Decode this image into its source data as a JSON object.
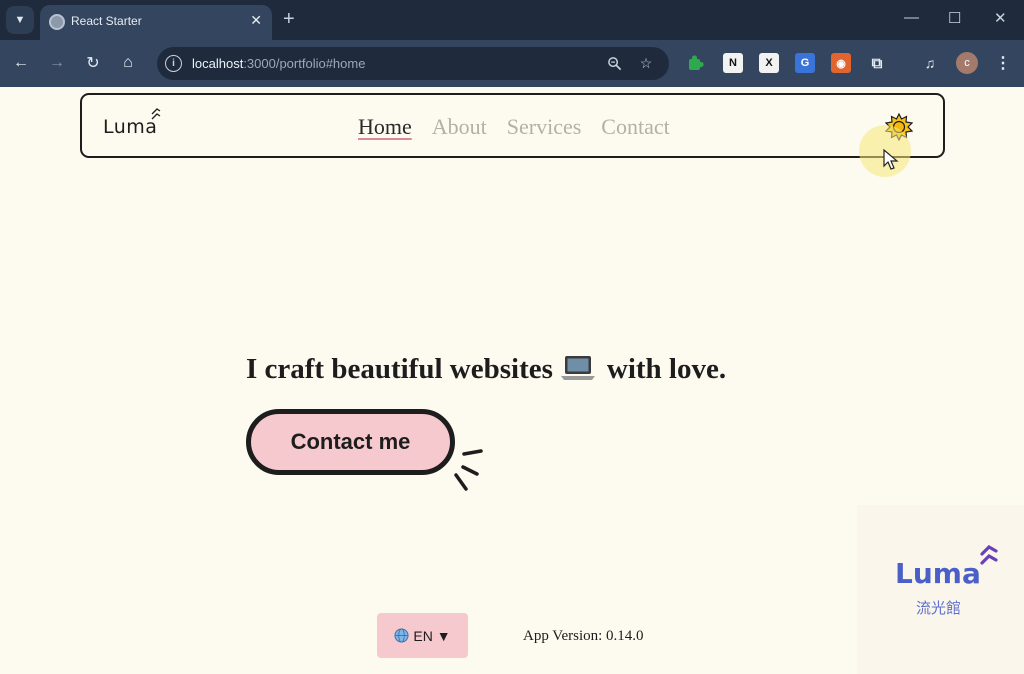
{
  "browser": {
    "tab_title": "React Starter",
    "url_host": "localhost",
    "url_path": ":3000/portfolio#home",
    "profile_initial": "c"
  },
  "nav": {
    "logo": "Luma",
    "links": [
      "Home",
      "About",
      "Services",
      "Contact"
    ],
    "active_link": "Home"
  },
  "hero": {
    "heading_before": "I craft beautiful websites",
    "heading_after": "with love.",
    "cta_label": "Contact me"
  },
  "footer": {
    "language": "EN ▼",
    "version": "App Version: 0.14.0"
  },
  "watermark": {
    "name": "Luma",
    "subtitle": "流光館"
  },
  "colors": {
    "page_bg": "#fdfaf0",
    "accent_pink": "#f6c9cf",
    "ink": "#1d1d1d",
    "nav_inactive": "#b4b0a8",
    "browser_dark": "#1f2b3d",
    "browser_toolbar": "#34465f",
    "watermark_blue": "#4a5fc8"
  },
  "icons": {
    "theme_toggle": "sun-icon",
    "hero_emoji": "laptop-icon",
    "language": "globe-icon"
  }
}
